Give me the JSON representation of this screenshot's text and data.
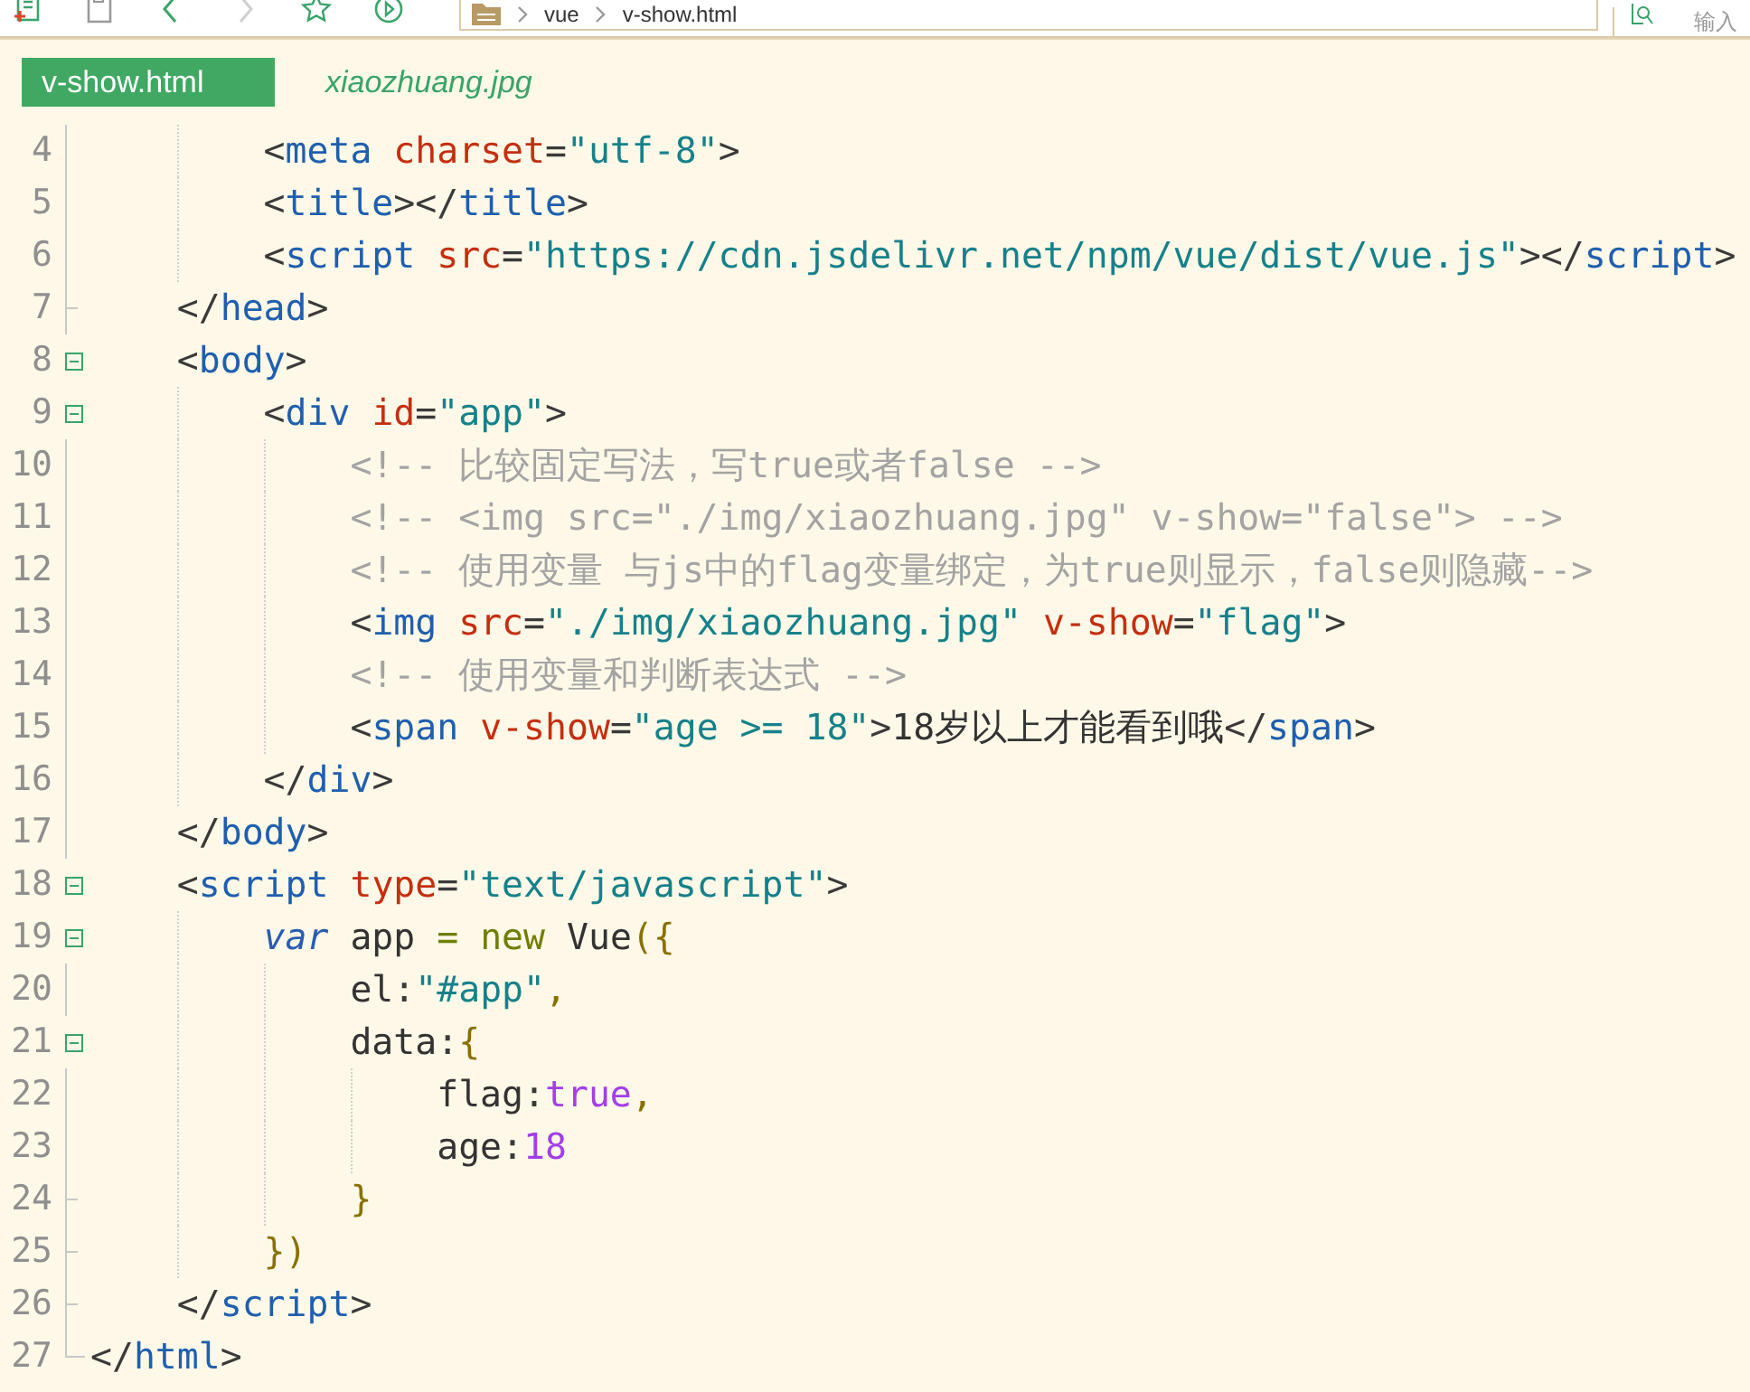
{
  "toolbar": {
    "buttons": [
      {
        "kind": "new-file",
        "disabled": false
      },
      {
        "kind": "save",
        "disabled": false
      },
      {
        "kind": "back",
        "disabled": false
      },
      {
        "kind": "forward",
        "disabled": true
      },
      {
        "kind": "star",
        "disabled": false
      },
      {
        "kind": "run",
        "disabled": false
      }
    ],
    "breadcrumb": [
      "vue",
      "v-show.html"
    ],
    "search": {
      "placeholder": "输入"
    }
  },
  "tabs": [
    {
      "label": "v-show.html",
      "selected": true
    },
    {
      "label": "xiaozhuang.jpg",
      "selected": false
    }
  ],
  "lines": [
    {
      "number": "4",
      "kind": "body",
      "tokens": [
        {
          "kind": "punct",
          "text": "        <"
        },
        {
          "kind": "tag",
          "text": "meta "
        },
        {
          "kind": "attr",
          "text": "charset"
        },
        {
          "kind": "punct",
          "text": "="
        },
        {
          "kind": "value",
          "text": "\"utf-8\""
        },
        {
          "kind": "punct",
          "text": ">"
        }
      ]
    },
    {
      "number": "5",
      "kind": "body",
      "tokens": [
        {
          "kind": "punct",
          "text": "        <"
        },
        {
          "kind": "tag",
          "text": "title"
        },
        {
          "kind": "punct",
          "text": "></"
        },
        {
          "kind": "tag",
          "text": "title"
        },
        {
          "kind": "punct",
          "text": ">"
        }
      ]
    },
    {
      "number": "6",
      "kind": "body",
      "tokens": [
        {
          "kind": "punct",
          "text": "        <"
        },
        {
          "kind": "tag",
          "text": "script "
        },
        {
          "kind": "attr",
          "text": "src"
        },
        {
          "kind": "punct",
          "text": "="
        },
        {
          "kind": "value",
          "text": "\"https://cdn.jsdelivr.net/npm/vue/dist/vue.js\""
        },
        {
          "kind": "punct",
          "text": "></"
        },
        {
          "kind": "tag",
          "text": "script"
        },
        {
          "kind": "punct",
          "text": ">"
        }
      ]
    },
    {
      "number": "7",
      "kind": "fold-end",
      "tokens": [
        {
          "kind": "punct",
          "text": "    </"
        },
        {
          "kind": "tag",
          "text": "head"
        },
        {
          "kind": "punct",
          "text": ">"
        }
      ]
    },
    {
      "number": "8",
      "kind": "fold-start",
      "tokens": [
        {
          "kind": "punct",
          "text": "    <"
        },
        {
          "kind": "tag",
          "text": "body"
        },
        {
          "kind": "punct",
          "text": ">"
        }
      ]
    },
    {
      "number": "9",
      "kind": "fold-start",
      "tokens": [
        {
          "kind": "punct",
          "text": "        <"
        },
        {
          "kind": "tag",
          "text": "div "
        },
        {
          "kind": "attr",
          "text": "id"
        },
        {
          "kind": "punct",
          "text": "="
        },
        {
          "kind": "value",
          "text": "\"app\""
        },
        {
          "kind": "punct",
          "text": ">"
        }
      ]
    },
    {
      "number": "10",
      "kind": "body",
      "tokens": [
        {
          "kind": "comment",
          "text": "            <!-- 比较固定写法，写true或者false -->"
        }
      ]
    },
    {
      "number": "11",
      "kind": "body",
      "tokens": [
        {
          "kind": "comment",
          "text": "            <!-- <img src=\"./img/xiaozhuang.jpg\" v-show=\"false\"> -->"
        }
      ]
    },
    {
      "number": "12",
      "kind": "body",
      "tokens": [
        {
          "kind": "comment",
          "text": "            <!-- 使用变量 与js中的flag变量绑定，为true则显示，false则隐藏-->"
        }
      ]
    },
    {
      "number": "13",
      "kind": "body",
      "tokens": [
        {
          "kind": "punct",
          "text": "            <"
        },
        {
          "kind": "tag",
          "text": "img "
        },
        {
          "kind": "attr",
          "text": "src"
        },
        {
          "kind": "punct",
          "text": "="
        },
        {
          "kind": "value",
          "text": "\"./img/xiaozhuang.jpg\" "
        },
        {
          "kind": "attr",
          "text": "v-show"
        },
        {
          "kind": "punct",
          "text": "="
        },
        {
          "kind": "value",
          "text": "\"flag\""
        },
        {
          "kind": "punct",
          "text": ">"
        }
      ]
    },
    {
      "number": "14",
      "kind": "body",
      "tokens": [
        {
          "kind": "comment",
          "text": "            <!-- 使用变量和判断表达式 -->"
        }
      ]
    },
    {
      "number": "15",
      "kind": "body",
      "tokens": [
        {
          "kind": "punct",
          "text": "            <"
        },
        {
          "kind": "tag",
          "text": "span "
        },
        {
          "kind": "attr",
          "text": "v-show"
        },
        {
          "kind": "punct",
          "text": "="
        },
        {
          "kind": "value",
          "text": "\"age >= 18\""
        },
        {
          "kind": "punct",
          "text": ">"
        },
        {
          "kind": "plain",
          "text": "18岁以上才能看到哦"
        },
        {
          "kind": "punct",
          "text": "</"
        },
        {
          "kind": "tag",
          "text": "span"
        },
        {
          "kind": "punct",
          "text": ">"
        }
      ]
    },
    {
      "number": "16",
      "kind": "body",
      "tokens": [
        {
          "kind": "punct",
          "text": "        </"
        },
        {
          "kind": "tag",
          "text": "div"
        },
        {
          "kind": "punct",
          "text": ">"
        }
      ]
    },
    {
      "number": "17",
      "kind": "body",
      "tokens": [
        {
          "kind": "punct",
          "text": "    </"
        },
        {
          "kind": "tag",
          "text": "body"
        },
        {
          "kind": "punct",
          "text": ">"
        }
      ]
    },
    {
      "number": "18",
      "kind": "fold-start",
      "tokens": [
        {
          "kind": "punct",
          "text": "    <"
        },
        {
          "kind": "tag",
          "text": "script "
        },
        {
          "kind": "attr",
          "text": "type"
        },
        {
          "kind": "punct",
          "text": "="
        },
        {
          "kind": "value",
          "text": "\"text/javascript\""
        },
        {
          "kind": "punct",
          "text": ">"
        }
      ]
    },
    {
      "number": "19",
      "kind": "fold-start",
      "tokens": [
        {
          "kind": "keyword",
          "text": "        var"
        },
        {
          "kind": "plain",
          "text": " app "
        },
        {
          "kind": "operator",
          "text": "= new"
        },
        {
          "kind": "plain",
          "text": " Vue"
        },
        {
          "kind": "brace",
          "text": "({"
        }
      ]
    },
    {
      "number": "20",
      "kind": "body",
      "tokens": [
        {
          "kind": "plain",
          "text": "            el"
        },
        {
          "kind": "punct",
          "text": ":"
        },
        {
          "kind": "value",
          "text": "\"#app\""
        },
        {
          "kind": "brace",
          "text": ","
        }
      ]
    },
    {
      "number": "21",
      "kind": "fold-start",
      "tokens": [
        {
          "kind": "plain",
          "text": "            data"
        },
        {
          "kind": "punct",
          "text": ":"
        },
        {
          "kind": "brace",
          "text": "{"
        }
      ]
    },
    {
      "number": "22",
      "kind": "body",
      "tokens": [
        {
          "kind": "plain",
          "text": "                flag"
        },
        {
          "kind": "punct",
          "text": ":"
        },
        {
          "kind": "literal",
          "text": "true"
        },
        {
          "kind": "brace",
          "text": ","
        }
      ]
    },
    {
      "number": "23",
      "kind": "body",
      "tokens": [
        {
          "kind": "plain",
          "text": "                age"
        },
        {
          "kind": "punct",
          "text": ":"
        },
        {
          "kind": "literal",
          "text": "18"
        }
      ]
    },
    {
      "number": "24",
      "kind": "fold-end",
      "tokens": [
        {
          "kind": "brace",
          "text": "            }"
        }
      ]
    },
    {
      "number": "25",
      "kind": "fold-end",
      "tokens": [
        {
          "kind": "brace",
          "text": "        })"
        }
      ]
    },
    {
      "number": "26",
      "kind": "fold-end",
      "tokens": [
        {
          "kind": "punct",
          "text": "    </"
        },
        {
          "kind": "tag",
          "text": "script"
        },
        {
          "kind": "punct",
          "text": ">"
        }
      ]
    },
    {
      "number": "27",
      "kind": "last",
      "tokens": [
        {
          "kind": "punct",
          "text": "</"
        },
        {
          "kind": "tag",
          "text": "html"
        },
        {
          "kind": "punct",
          "text": ">"
        }
      ]
    }
  ]
}
